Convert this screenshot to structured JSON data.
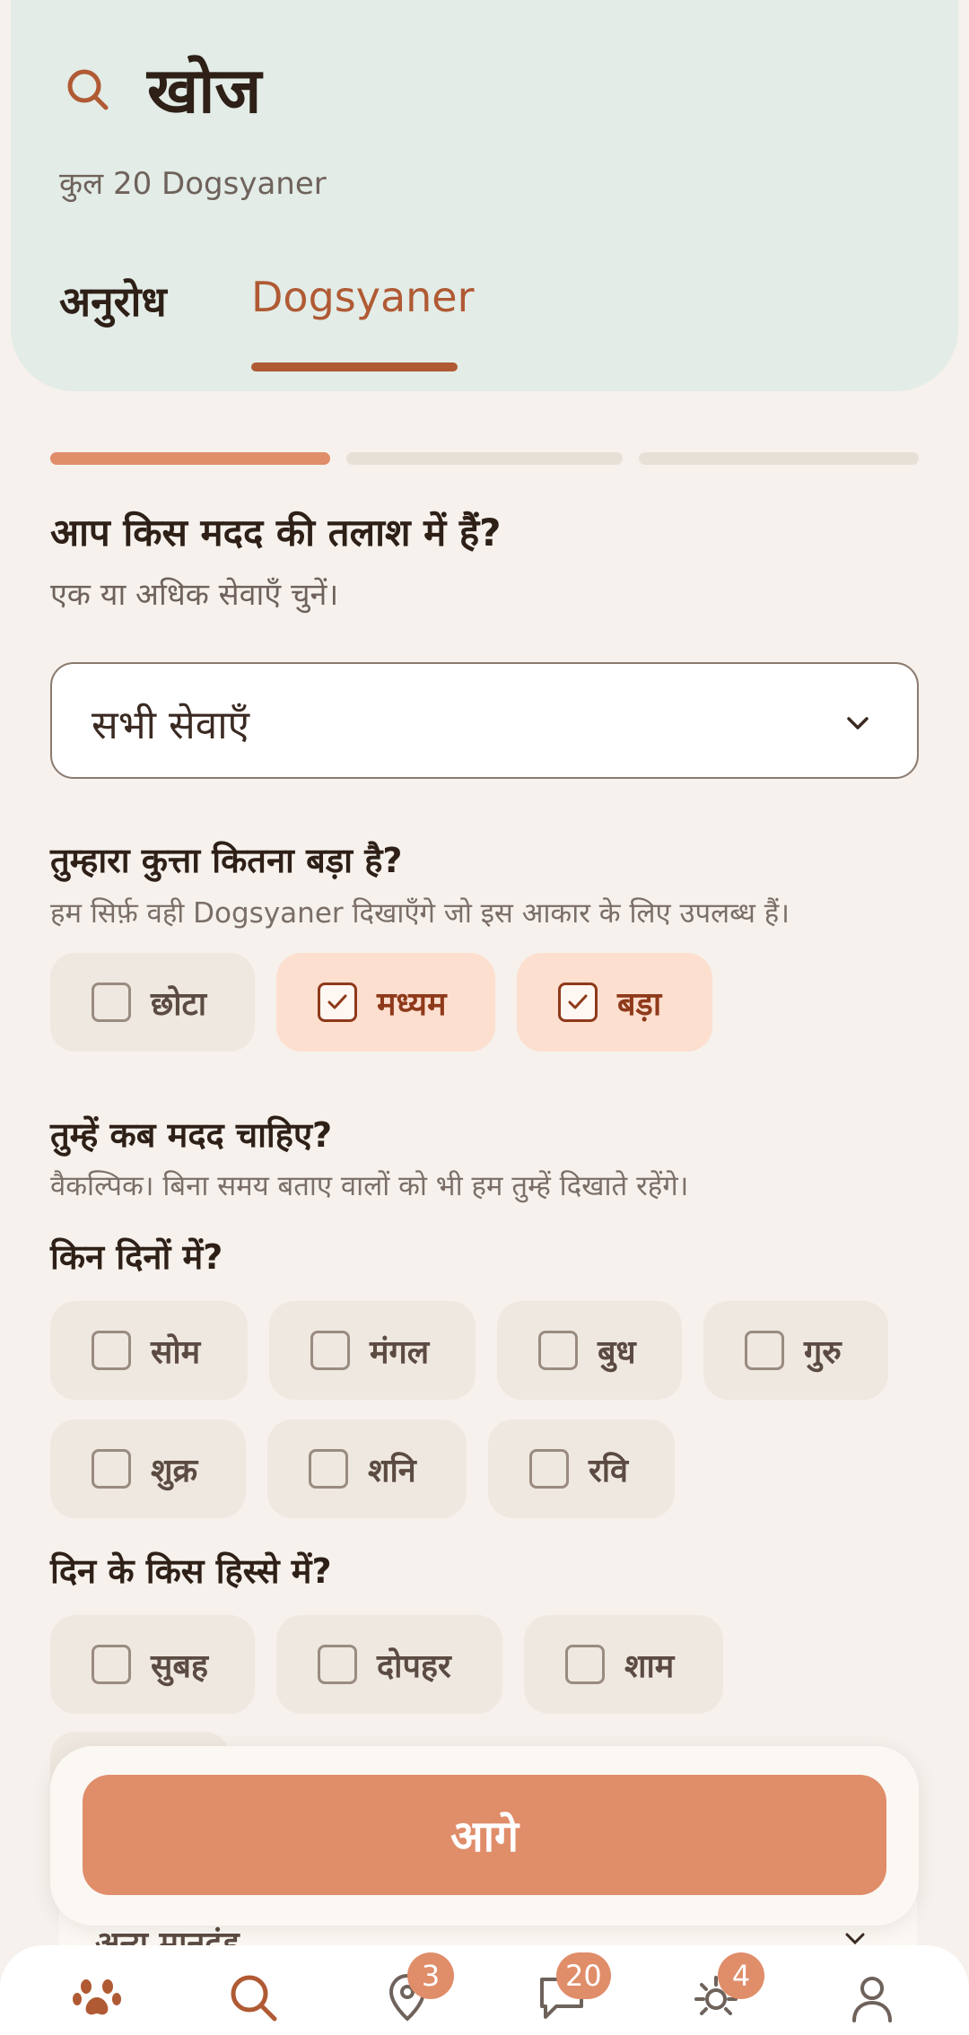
{
  "header": {
    "title": "खोज",
    "subtitle": "कुल 20 Dogsyaner",
    "tabs": [
      {
        "label": "अनुरोध",
        "active": false
      },
      {
        "label": "Dogsyaner",
        "active": true
      }
    ]
  },
  "progress": {
    "current_step": 1,
    "total_steps": 3
  },
  "services": {
    "title": "आप किस मदद की तलाश में हैं?",
    "subtitle": "एक या अधिक सेवाएँ चुनें।",
    "selected": "सभी सेवाएँ"
  },
  "size": {
    "title": "तुम्हारा कुत्ता कितना बड़ा है?",
    "subtitle": "हम सिर्फ़ वही Dogsyaner दिखाएँगे जो इस आकार के लिए उपलब्ध हैं।",
    "options": [
      {
        "label": "छोटा",
        "checked": false
      },
      {
        "label": "मध्यम",
        "checked": true
      },
      {
        "label": "बड़ा",
        "checked": true
      }
    ]
  },
  "when": {
    "title": "तुम्हें कब मदद चाहिए?",
    "subtitle": "वैकल्पिक। बिना समय बताए वालों को भी हम तुम्हें दिखाते रहेंगे।",
    "days_title": "किन दिनों में?",
    "days": [
      {
        "label": "सोम",
        "checked": false
      },
      {
        "label": "मंगल",
        "checked": false
      },
      {
        "label": "बुध",
        "checked": false
      },
      {
        "label": "गुरु",
        "checked": false
      },
      {
        "label": "शुक्र",
        "checked": false
      },
      {
        "label": "शनि",
        "checked": false
      },
      {
        "label": "रवि",
        "checked": false
      }
    ],
    "times_title": "दिन के किस हिस्से में?",
    "times": [
      {
        "label": "सुबह",
        "checked": false
      },
      {
        "label": "दोपहर",
        "checked": false
      },
      {
        "label": "शाम",
        "checked": false
      }
    ]
  },
  "more_criteria": "अन्य मानदंड",
  "next_button": "आगे",
  "nav": {
    "items": [
      {
        "name": "paw-icon",
        "badge": null
      },
      {
        "name": "search-icon",
        "badge": null,
        "active": true
      },
      {
        "name": "location-pin-icon",
        "badge": "3"
      },
      {
        "name": "chat-icon",
        "badge": "20"
      },
      {
        "name": "sun-icon",
        "badge": "4"
      },
      {
        "name": "profile-icon",
        "badge": null
      }
    ]
  },
  "colors": {
    "accent": "#e08d6a",
    "brand_dark": "#b05a34",
    "header_bg": "#e3ece7",
    "chip_selected_bg": "#fddfd0"
  }
}
